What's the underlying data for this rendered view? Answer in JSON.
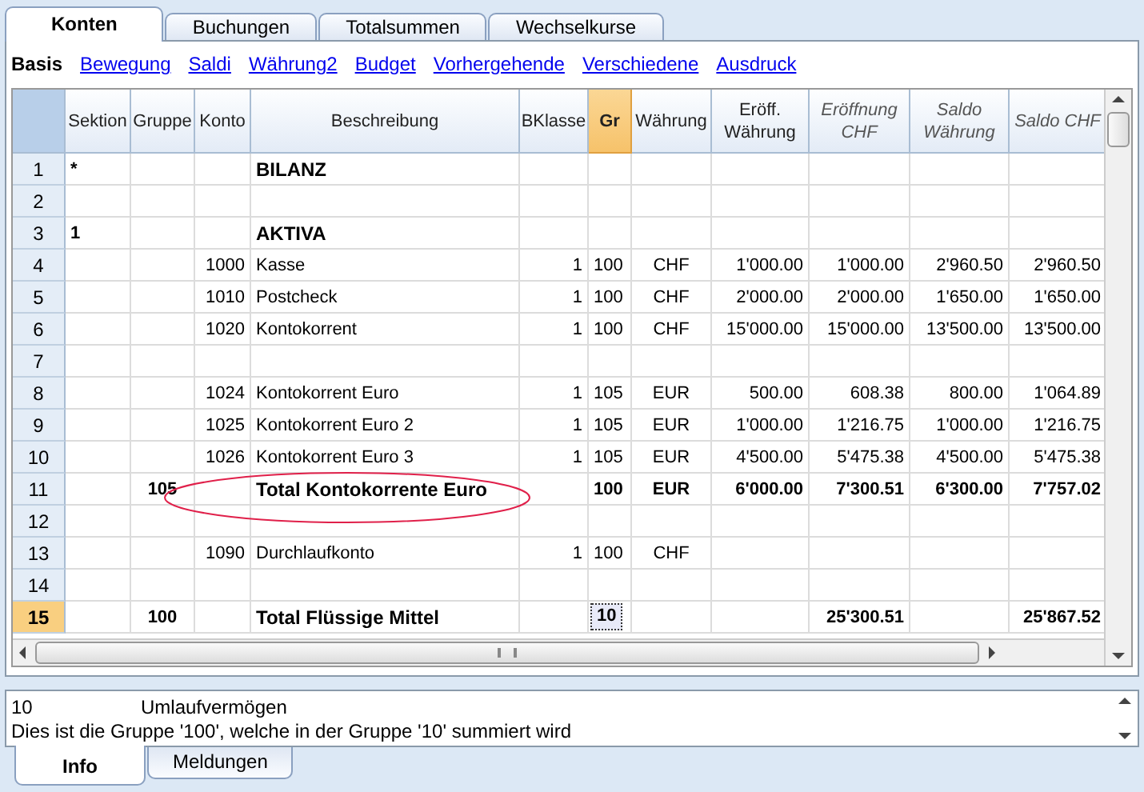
{
  "tabs": [
    {
      "label": "Konten",
      "selected": true
    },
    {
      "label": "Buchungen",
      "selected": false
    },
    {
      "label": "Totalsummen",
      "selected": false
    },
    {
      "label": "Wechselkurse",
      "selected": false
    }
  ],
  "views": [
    {
      "label": "Basis",
      "selected": true
    },
    {
      "label": "Bewegung",
      "selected": false
    },
    {
      "label": "Saldi",
      "selected": false
    },
    {
      "label": "Währung2",
      "selected": false
    },
    {
      "label": "Budget",
      "selected": false
    },
    {
      "label": "Vorhergehende",
      "selected": false
    },
    {
      "label": "Verschiedene",
      "selected": false
    },
    {
      "label": "Ausdruck",
      "selected": false
    }
  ],
  "table": {
    "columns": [
      {
        "label": "Sektion",
        "italic": false,
        "selected": false
      },
      {
        "label": "Gruppe",
        "italic": false,
        "selected": false
      },
      {
        "label": "Konto",
        "italic": false,
        "selected": false
      },
      {
        "label": "Beschreibung",
        "italic": false,
        "selected": false
      },
      {
        "label": "BKlasse",
        "italic": false,
        "selected": false
      },
      {
        "label": "Gr",
        "italic": false,
        "selected": true
      },
      {
        "label": "Währung",
        "italic": false,
        "selected": false
      },
      {
        "label": "Eröff. Währung",
        "italic": false,
        "selected": false
      },
      {
        "label": "Eröffnung CHF",
        "italic": true,
        "selected": false
      },
      {
        "label": "Saldo Währung",
        "italic": true,
        "selected": false
      },
      {
        "label": "Saldo CHF",
        "italic": true,
        "selected": false
      }
    ],
    "rows": [
      {
        "number": "1",
        "bold": true,
        "selected": false,
        "cells": [
          "*",
          null,
          null,
          "BILANZ",
          null,
          null,
          null,
          null,
          null,
          null,
          null
        ]
      },
      {
        "number": "2",
        "selected": false,
        "cells": [
          null,
          null,
          null,
          null,
          null,
          null,
          null,
          null,
          null,
          null,
          null
        ]
      },
      {
        "number": "3",
        "bold": true,
        "selected": false,
        "cells": [
          "1",
          null,
          null,
          "AKTIVA",
          null,
          null,
          null,
          null,
          null,
          null,
          null
        ]
      },
      {
        "number": "4",
        "bold": false,
        "selected": false,
        "cells": [
          null,
          null,
          "1000",
          "Kasse",
          "1",
          "100",
          "CHF",
          "1'000.00",
          "1'000.00",
          "2'960.50",
          "2'960.50"
        ]
      },
      {
        "number": "5",
        "bold": false,
        "selected": false,
        "cells": [
          null,
          null,
          "1010",
          "Postcheck",
          "1",
          "100",
          "CHF",
          "2'000.00",
          "2'000.00",
          "1'650.00",
          "1'650.00"
        ]
      },
      {
        "number": "6",
        "bold": false,
        "selected": false,
        "cells": [
          null,
          null,
          "1020",
          "Kontokorrent",
          "1",
          "100",
          "CHF",
          "15'000.00",
          "15'000.00",
          "13'500.00",
          "13'500.00"
        ]
      },
      {
        "number": "7",
        "selected": false,
        "cells": [
          null,
          null,
          null,
          null,
          null,
          null,
          null,
          null,
          null,
          null,
          null
        ]
      },
      {
        "number": "8",
        "bold": false,
        "selected": false,
        "cells": [
          null,
          null,
          "1024",
          "Kontokorrent Euro",
          "1",
          "105",
          "EUR",
          "500.00",
          "608.38",
          "800.00",
          "1'064.89"
        ]
      },
      {
        "number": "9",
        "bold": false,
        "selected": false,
        "cells": [
          null,
          null,
          "1025",
          "Kontokorrent Euro 2",
          "1",
          "105",
          "EUR",
          "1'000.00",
          "1'216.75",
          "1'000.00",
          "1'216.75"
        ]
      },
      {
        "number": "10",
        "bold": false,
        "selected": false,
        "cells": [
          null,
          null,
          "1026",
          "Kontokorrent Euro 3",
          "1",
          "105",
          "EUR",
          "4'500.00",
          "5'475.38",
          "4'500.00",
          "5'475.38"
        ]
      },
      {
        "number": "11",
        "bold": true,
        "selected": false,
        "circled": true,
        "cells": [
          null,
          "105",
          null,
          "Total Kontokorrente Euro",
          null,
          "100",
          "EUR",
          "6'000.00",
          "7'300.51",
          "6'300.00",
          "7'757.02"
        ]
      },
      {
        "number": "12",
        "selected": false,
        "cells": [
          null,
          null,
          null,
          null,
          null,
          null,
          null,
          null,
          null,
          null,
          null
        ]
      },
      {
        "number": "13",
        "bold": false,
        "selected": false,
        "cells": [
          null,
          null,
          "1090",
          "Durchlaufkonto",
          "1",
          "100",
          "CHF",
          null,
          null,
          null,
          null
        ]
      },
      {
        "number": "14",
        "selected": false,
        "cells": [
          null,
          null,
          null,
          null,
          null,
          null,
          null,
          null,
          null,
          null,
          null
        ]
      },
      {
        "number": "15",
        "bold": true,
        "selected": true,
        "cells": [
          null,
          "100",
          null,
          "Total Flüssige Mittel",
          null,
          "10",
          null,
          null,
          "25'300.51",
          null,
          "25'867.52"
        ]
      }
    ]
  },
  "info": {
    "group": "10",
    "description": "Umlaufvermögen",
    "message": "Dies ist die Gruppe '100', welche in der Gruppe '10' summiert wird"
  },
  "bottom_tabs": [
    {
      "label": "Info",
      "selected": true
    },
    {
      "label": "Meldungen",
      "selected": false
    }
  ]
}
